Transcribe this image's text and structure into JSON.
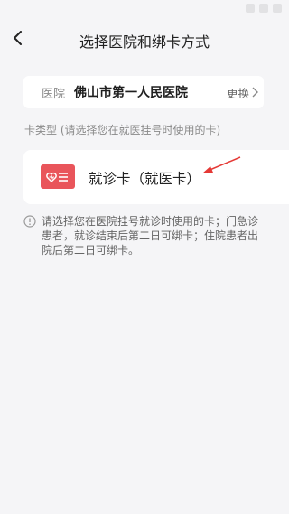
{
  "header": {
    "title": "选择医院和绑卡方式"
  },
  "hospital": {
    "label": "医院",
    "name": "佛山市第一人民医院",
    "change_label": "更换"
  },
  "card_type": {
    "section_label": "卡类型 (请选择您在就医挂号时使用的卡)",
    "option_label": "就诊卡（就医卡）"
  },
  "notice": {
    "text": "请选择您在医院挂号就诊时使用的卡；门急诊\n患者，就诊结束后第二日可绑卡；住院患者出\n院后第二日可绑卡。"
  },
  "icons": {
    "back": "back-arrow-icon",
    "chevron": "chevron-right-icon",
    "card": "medical-card-icon",
    "info": "info-icon",
    "annotation": "red-arrow-annotation"
  },
  "colors": {
    "accent": "#e9555b",
    "background": "#f5f5f7",
    "card": "#ffffff",
    "annotation": "#e53935"
  }
}
